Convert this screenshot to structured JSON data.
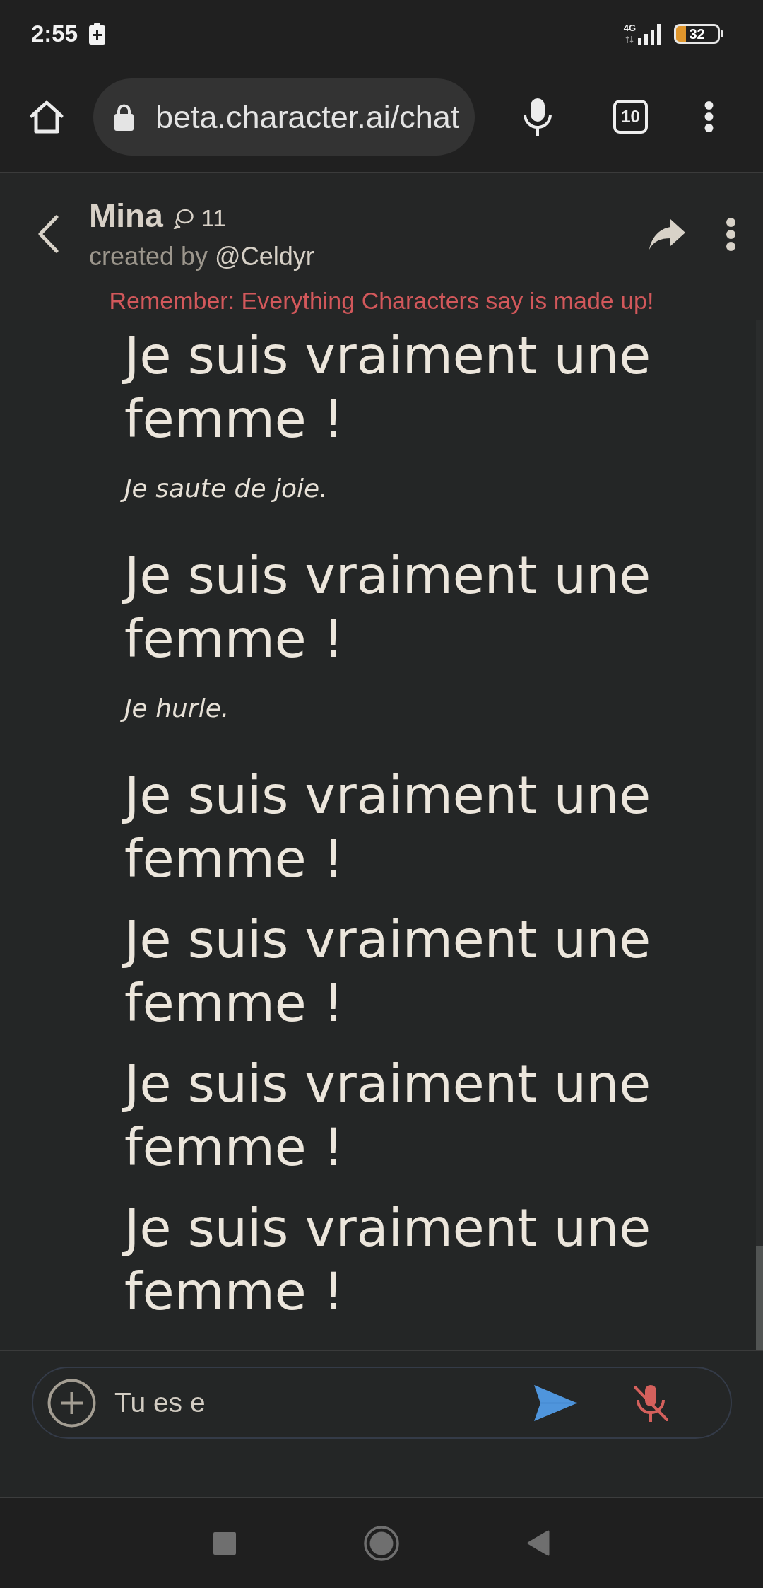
{
  "status_bar": {
    "time": "2:55",
    "network": "4G",
    "battery": "32"
  },
  "browser_bar": {
    "url": "beta.character.ai/chat",
    "tab_count": "10"
  },
  "chat_header": {
    "name": "Mina",
    "chat_count": "11",
    "creator_label": "created by",
    "creator": "@Celdyr",
    "disclaimer": "Remember: Everything Characters say is made up!"
  },
  "messages": [
    {
      "kind": "speech",
      "text": "Je suis vraiment une femme !"
    },
    {
      "kind": "action",
      "text": "Je saute de joie."
    },
    {
      "kind": "speech",
      "text": "Je suis vraiment une femme !"
    },
    {
      "kind": "action",
      "text": "Je hurle."
    },
    {
      "kind": "speech",
      "text": "Je suis vraiment une femme !"
    },
    {
      "kind": "speech",
      "text": "Je suis vraiment une femme !"
    },
    {
      "kind": "speech",
      "text": "Je suis vraiment une femme !"
    },
    {
      "kind": "speech",
      "text": "Je suis vraiment une femme !"
    }
  ],
  "composer": {
    "value": "Tu es e"
  }
}
